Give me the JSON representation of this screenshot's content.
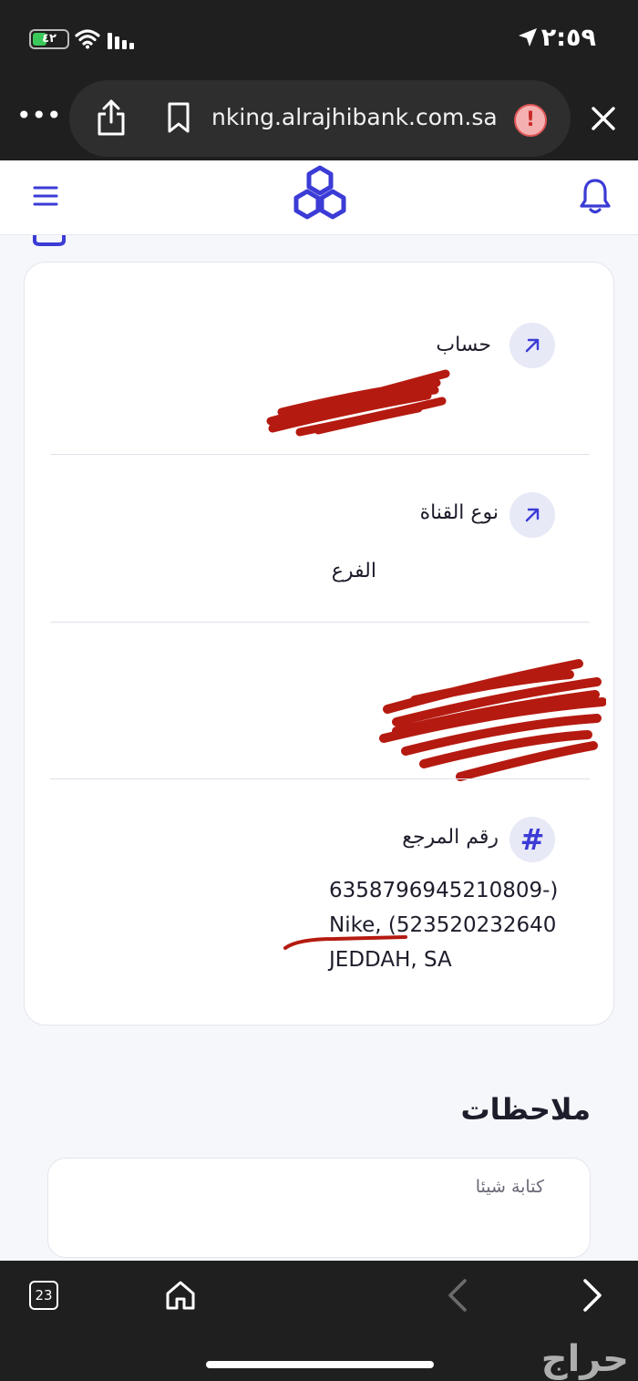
{
  "status_bar": {
    "time": "٢:٥٩",
    "battery": "٤٢",
    "battery_level": 0.42
  },
  "browser": {
    "url": "nking.alrajhibank.com.sa",
    "more_label": "•••"
  },
  "details": {
    "account_label": "حساب",
    "channel_label": "نوع القناة",
    "channel_value": "الفرع",
    "reference_label": "رقم المرجع",
    "reference_lines": [
      "6358796945210809-)",
      "Nike, (523520232640",
      "JEDDAH, SA"
    ]
  },
  "notes": {
    "title": "ملاحظات",
    "placeholder": "كتابة شيئا"
  },
  "toolbar": {
    "tab_count": "23"
  },
  "watermark": "حراج",
  "colors": {
    "accent": "#3b3bd6",
    "redaction": "#b51a10"
  }
}
